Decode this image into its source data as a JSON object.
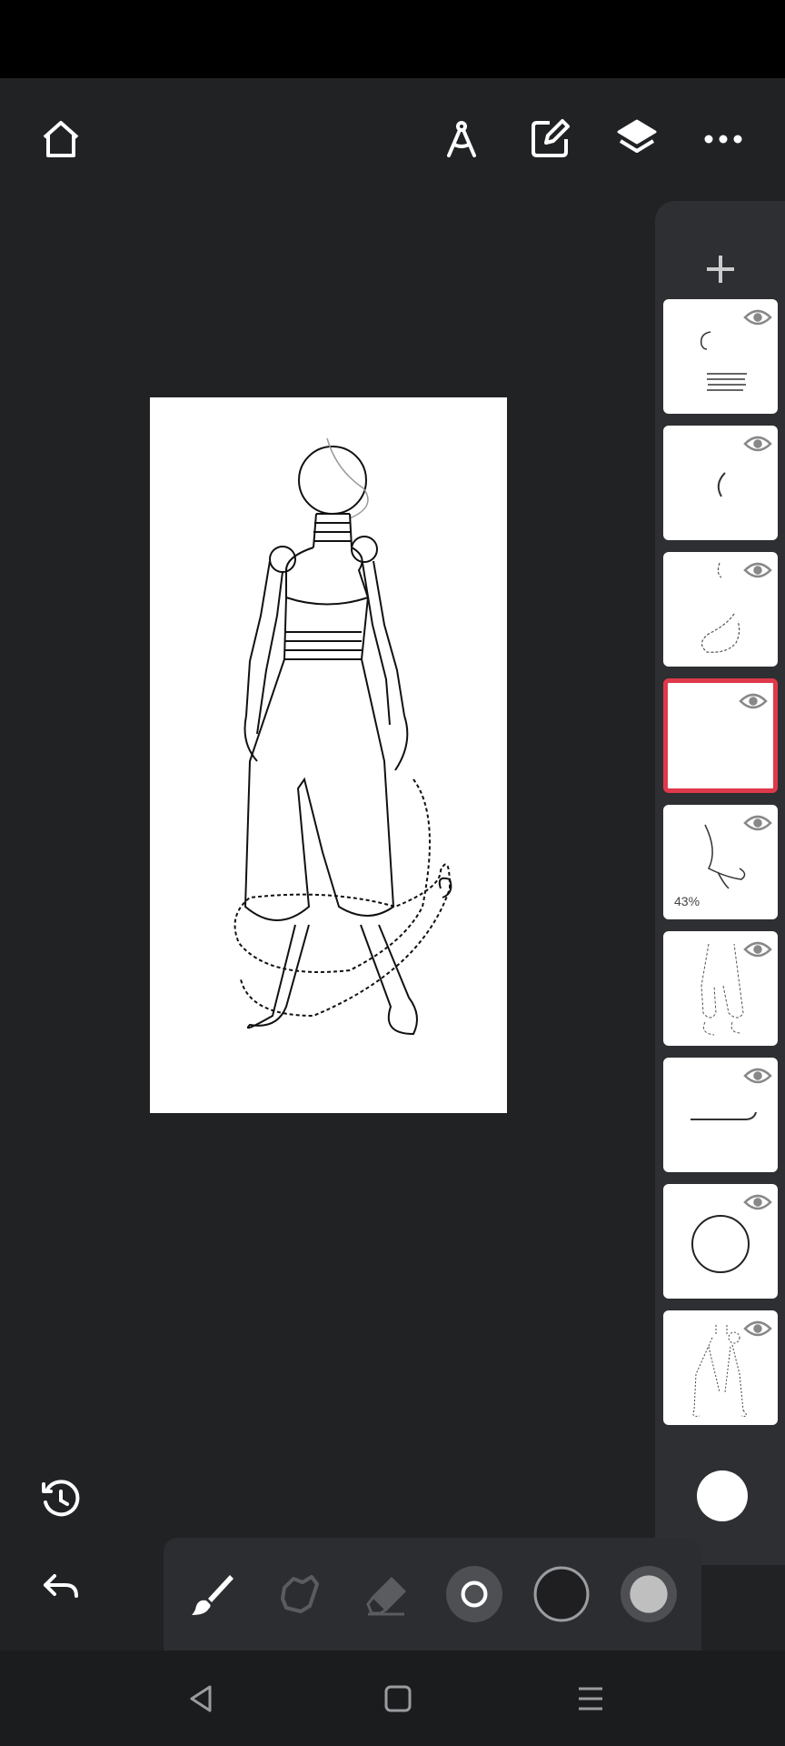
{
  "app": {
    "top_toolbar": [
      "home-icon",
      "ruler-compass-icon",
      "edit-canvas-icon",
      "layers-icon",
      "more-icon"
    ]
  },
  "layers": [
    {
      "index": 1,
      "visible": true,
      "selected": false,
      "opacity_label": ""
    },
    {
      "index": 2,
      "visible": true,
      "selected": false,
      "opacity_label": ""
    },
    {
      "index": 3,
      "visible": true,
      "selected": false,
      "opacity_label": ""
    },
    {
      "index": 4,
      "visible": true,
      "selected": true,
      "opacity_label": ""
    },
    {
      "index": 5,
      "visible": true,
      "selected": false,
      "opacity_label": "43%"
    },
    {
      "index": 6,
      "visible": true,
      "selected": false,
      "opacity_label": ""
    },
    {
      "index": 7,
      "visible": true,
      "selected": false,
      "opacity_label": ""
    },
    {
      "index": 8,
      "visible": true,
      "selected": false,
      "opacity_label": ""
    },
    {
      "index": 9,
      "visible": true,
      "selected": false,
      "opacity_label": ""
    }
  ],
  "layer5": {
    "opacity_label": "43%"
  },
  "current_color": "#ffffff",
  "accent_color": "#e0394b",
  "bottom_tools": [
    "brush-icon",
    "smudge-icon",
    "eraser-icon",
    "brush-size-icon",
    "brush-color-icon",
    "brush-opacity-icon"
  ],
  "nav": [
    "back-icon",
    "home-square-icon",
    "recents-icon"
  ]
}
